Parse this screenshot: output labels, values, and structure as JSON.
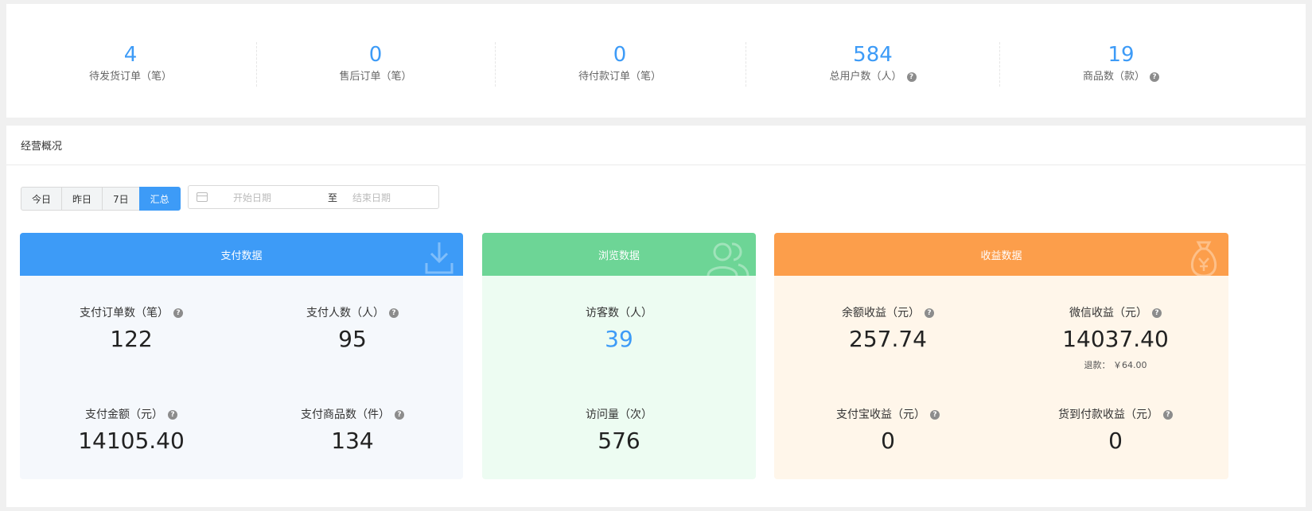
{
  "stats": [
    {
      "value": "4",
      "label": "待发货订单（笔）"
    },
    {
      "value": "0",
      "label": "售后订单（笔）"
    },
    {
      "value": "0",
      "label": "待付款订单（笔）"
    },
    {
      "value": "584",
      "label": "总用户数（人）"
    },
    {
      "value": "19",
      "label": "商品数（款）"
    }
  ],
  "overview": {
    "title": "经营概况",
    "range_buttons": [
      "今日",
      "昨日",
      "7日",
      "汇总"
    ],
    "date_start_placeholder": "开始日期",
    "date_separator": "至",
    "date_end_placeholder": "结束日期"
  },
  "payment": {
    "title": "支付数据",
    "color": "#3d9bf7",
    "bg": "#f5f8fc",
    "order_count_label": "支付订单数（笔）",
    "order_count": "122",
    "payer_count_label": "支付人数（人）",
    "payer_count": "95",
    "amount_label": "支付金额（元）",
    "amount": "14105.40",
    "goods_count_label": "支付商品数（件）",
    "goods_count": "134"
  },
  "browse": {
    "title": "浏览数据",
    "color": "#6dd596",
    "bg": "#edfcf2",
    "visitors_label": "访客数（人）",
    "visitors": "39",
    "views_label": "访问量（次）",
    "views": "576"
  },
  "income": {
    "title": "收益数据",
    "color": "#fc9e4b",
    "bg": "#fff6ea",
    "balance_label": "余额收益（元）",
    "balance": "257.74",
    "wechat_label": "微信收益（元）",
    "wechat": "14037.40",
    "refund_text": "退款： ￥64.00",
    "alipay_label": "支付宝收益（元）",
    "alipay": "0",
    "cod_label": "货到付款收益（元）",
    "cod": "0"
  }
}
